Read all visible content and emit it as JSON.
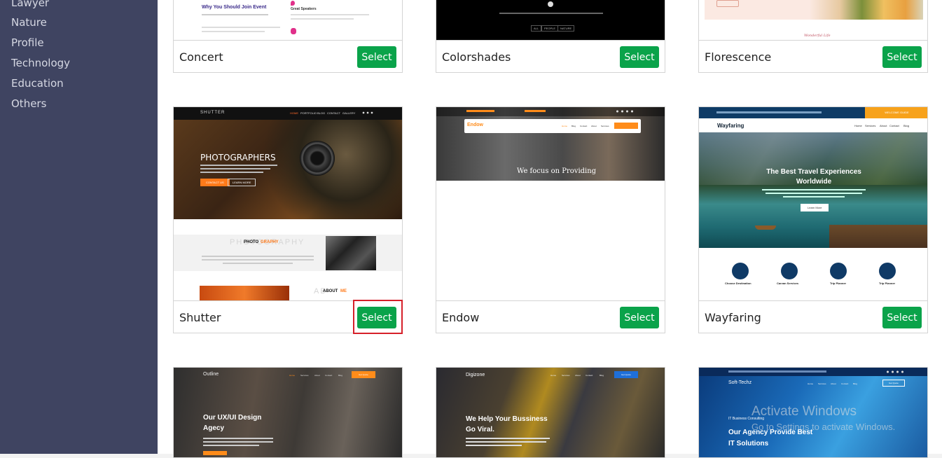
{
  "sidebar": {
    "items": [
      "Lawyer",
      "Nature",
      "Profile",
      "Technology",
      "Education",
      "Others"
    ]
  },
  "cards": [
    {
      "name": "Concert",
      "select_label": "Select"
    },
    {
      "name": "Colorshades",
      "select_label": "Select"
    },
    {
      "name": "Florescence",
      "select_label": "Select"
    },
    {
      "name": "Shutter",
      "select_label": "Select"
    },
    {
      "name": "Endow",
      "select_label": "Select"
    },
    {
      "name": "Wayfaring",
      "select_label": "Select"
    }
  ],
  "previews": {
    "concert": {
      "heading": "Why You Should Join Event",
      "speakers": "Great Speakers"
    },
    "colorshades": {
      "buttons": [
        "ALL",
        "PEOPLE",
        "NATURE"
      ]
    },
    "florescence": {
      "script": "Wonderful Life"
    },
    "shutter": {
      "logo": "SHUTTER",
      "nav": [
        "HOME",
        "PORTFOLIO",
        "BLOG",
        "CONTACT",
        "GALLERY"
      ],
      "hero": "PHOTOGRAPHERS",
      "btn1": "CONTACT US",
      "btn2": "LEARN MORE",
      "section1_bg": "PHOTOGRAPHY",
      "section1_a": "PHOTO",
      "section1_b": "GRAPHY",
      "section2_a": "ABOUT",
      "section2_b": "ME"
    },
    "endow": {
      "logo": "Endow",
      "nav": [
        "Home",
        "Blog",
        "Contact",
        "About",
        "Services"
      ],
      "hero": "We focus on Providing"
    },
    "wayfaring": {
      "logo": "Wayfaring",
      "nav": [
        "Home",
        "Services",
        "About",
        "Contact",
        "Blog"
      ],
      "topbtn": "WELCOME GUIDE",
      "hero1": "The Best Travel Experiences",
      "hero2": "Worldwide",
      "btn": "Learn More",
      "features": [
        "Choose Destination",
        "Carvan Services",
        "Trip Planner",
        "Trip Planner"
      ]
    },
    "outline": {
      "logo": "Outline",
      "hero1": "Our UX/UI Design",
      "hero2": "Agecy",
      "btn": "Get Quote",
      "nav": [
        "Home",
        "Services",
        "About",
        "Contact",
        "Blog"
      ]
    },
    "digizone": {
      "logo": "Digizone",
      "hero1": "We Help Your Bussiness",
      "hero2": "Go Viral.",
      "btn": "Get Quote",
      "nav": [
        "Home",
        "Services",
        "About",
        "Contact",
        "Blog"
      ]
    },
    "softtechz": {
      "logo": "Soft-Techz",
      "tag": "IT Business Consulting",
      "hero1": "Our Agency Provide Best",
      "hero2": "IT Solutions",
      "btn": "Get Quote",
      "nav": [
        "Home",
        "Services",
        "About",
        "Contact",
        "Blog"
      ]
    }
  },
  "watermark": {
    "line1": "Activate Windows",
    "line2": "Go to Settings to activate Windows."
  },
  "colors": {
    "sidebar": "#3f4461",
    "select_button": "#0aa34a",
    "highlight": "#d6202a"
  }
}
